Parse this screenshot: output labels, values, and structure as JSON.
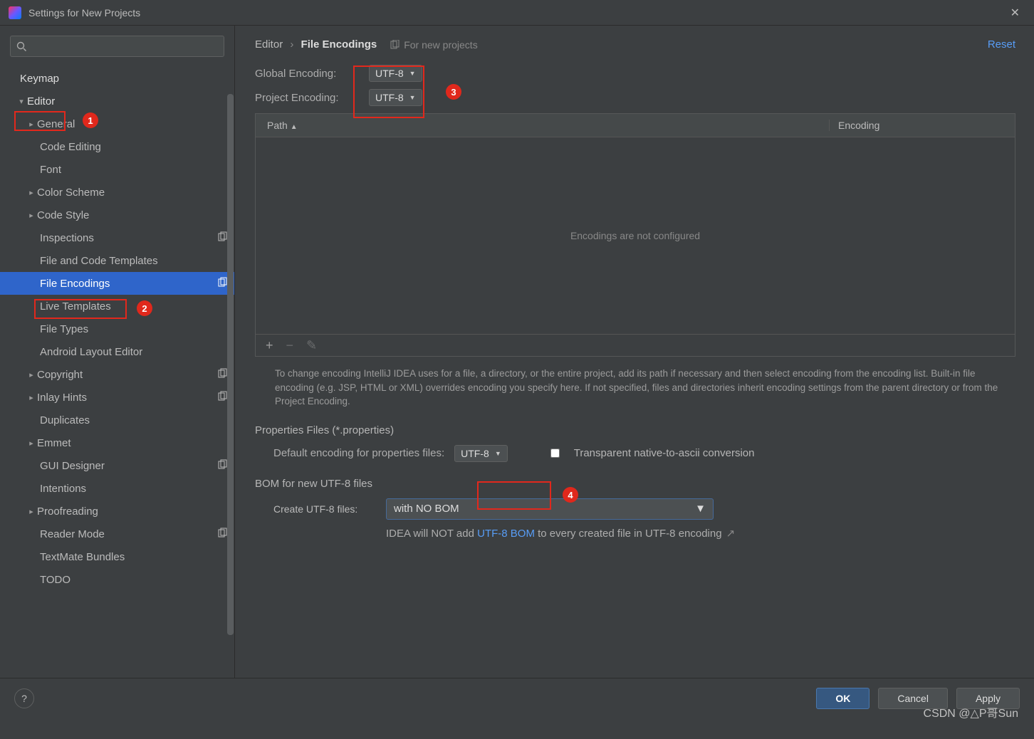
{
  "window": {
    "title": "Settings for New Projects"
  },
  "sidebar": {
    "items": [
      {
        "label": "Keymap",
        "kind": "top"
      },
      {
        "label": "Editor",
        "kind": "top-expanded",
        "highlight": true
      },
      {
        "label": "General",
        "kind": "sub-exp"
      },
      {
        "label": "Code Editing",
        "kind": "sub"
      },
      {
        "label": "Font",
        "kind": "sub"
      },
      {
        "label": "Color Scheme",
        "kind": "sub-exp"
      },
      {
        "label": "Code Style",
        "kind": "sub-exp"
      },
      {
        "label": "Inspections",
        "kind": "sub",
        "copy": true
      },
      {
        "label": "File and Code Templates",
        "kind": "sub"
      },
      {
        "label": "File Encodings",
        "kind": "sub",
        "selected": true,
        "copy": true
      },
      {
        "label": "Live Templates",
        "kind": "sub"
      },
      {
        "label": "File Types",
        "kind": "sub"
      },
      {
        "label": "Android Layout Editor",
        "kind": "sub"
      },
      {
        "label": "Copyright",
        "kind": "sub-exp",
        "copy": true
      },
      {
        "label": "Inlay Hints",
        "kind": "sub-exp",
        "copy": true
      },
      {
        "label": "Duplicates",
        "kind": "sub"
      },
      {
        "label": "Emmet",
        "kind": "sub-exp"
      },
      {
        "label": "GUI Designer",
        "kind": "sub",
        "copy": true
      },
      {
        "label": "Intentions",
        "kind": "sub"
      },
      {
        "label": "Proofreading",
        "kind": "sub-exp"
      },
      {
        "label": "Reader Mode",
        "kind": "sub",
        "copy": true
      },
      {
        "label": "TextMate Bundles",
        "kind": "sub"
      },
      {
        "label": "TODO",
        "kind": "sub"
      }
    ]
  },
  "breadcrumb": {
    "root": "Editor",
    "leaf": "File Encodings",
    "hint": "For new projects",
    "reset": "Reset"
  },
  "form": {
    "global_label": "Global Encoding:",
    "global_value": "UTF-8",
    "project_label": "Project Encoding:",
    "project_value": "UTF-8"
  },
  "table": {
    "col_path": "Path",
    "col_enc": "Encoding",
    "empty": "Encodings are not configured"
  },
  "description": "To change encoding IntelliJ IDEA uses for a file, a directory, or the entire project, add its path if necessary and then select encoding from the encoding list. Built-in file encoding (e.g. JSP, HTML or XML) overrides encoding you specify here. If not specified, files and directories inherit encoding settings from the parent directory or from the Project Encoding.",
  "properties": {
    "title": "Properties Files (*.properties)",
    "label": "Default encoding for properties files:",
    "value": "UTF-8",
    "checkbox": "Transparent native-to-ascii conversion"
  },
  "bom": {
    "title": "BOM for new UTF-8 files",
    "label": "Create UTF-8 files:",
    "value": "with NO BOM",
    "note_prefix": "IDEA will NOT add ",
    "note_link": "UTF-8 BOM",
    "note_suffix": " to every created file in UTF-8 encoding"
  },
  "buttons": {
    "ok": "OK",
    "cancel": "Cancel",
    "apply": "Apply",
    "help": "?"
  },
  "watermark": "CSDN @△P哥Sun",
  "annotations": {
    "b1": "1",
    "b2": "2",
    "b3": "3",
    "b4": "4"
  }
}
